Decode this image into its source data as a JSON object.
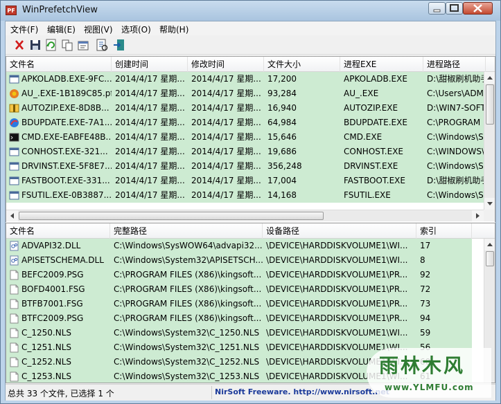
{
  "window": {
    "title": "WinPrefetchView",
    "icon_text": "PF"
  },
  "menu": [
    "文件(F)",
    "编辑(E)",
    "视图(V)",
    "选项(O)",
    "帮助(H)"
  ],
  "toolbar": [
    "delete-icon",
    "save-icon",
    "refresh-icon",
    "copy-icon",
    "properties-icon",
    "html-report-icon",
    "exit-icon"
  ],
  "top_table": {
    "headers": [
      "文件名",
      "创建时间",
      "修改时间",
      "文件大小",
      "进程EXE",
      "进程路径"
    ],
    "rows": [
      {
        "icon": "generic-exe-icon",
        "cells": [
          "APKOLADB.EXE-9FC...",
          "2014/4/17 星期...",
          "2014/4/17 星期...",
          "17,200",
          "APKOLADB.EXE",
          "D:\\甜椒刷机助手"
        ]
      },
      {
        "icon": "app-color-icon",
        "cells": [
          "AU_.EXE-1B189C85.pf",
          "2014/4/17 星期...",
          "2014/4/17 星期...",
          "93,284",
          "AU_.EXE",
          "C:\\Users\\ADM"
        ]
      },
      {
        "icon": "zip-icon",
        "cells": [
          "AUTOZIP.EXE-8D8B...",
          "2014/4/17 星期...",
          "2014/4/17 星期...",
          "16,940",
          "AUTOZIP.EXE",
          "D:\\WIN7-SOFT"
        ]
      },
      {
        "icon": "update-icon",
        "cells": [
          "BDUPDATE.EXE-7A1...",
          "2014/4/17 星期...",
          "2014/4/17 星期...",
          "64,984",
          "BDUPDATE.EXE",
          "C:\\PROGRAM"
        ]
      },
      {
        "icon": "cmd-icon",
        "cells": [
          "CMD.EXE-EABFE48B...",
          "2014/4/17 星期...",
          "2014/4/17 星期...",
          "15,646",
          "CMD.EXE",
          "C:\\Windows\\Sy"
        ]
      },
      {
        "icon": "generic-exe-icon",
        "cells": [
          "CONHOST.EXE-321...",
          "2014/4/17 星期...",
          "2014/4/17 星期...",
          "19,686",
          "CONHOST.EXE",
          "C:\\WINDOWS\\"
        ]
      },
      {
        "icon": "generic-exe-icon",
        "cells": [
          "DRVINST.EXE-5F8E7...",
          "2014/4/17 星期...",
          "2014/4/17 星期...",
          "356,248",
          "DRVINST.EXE",
          "C:\\Windows\\Sy"
        ]
      },
      {
        "icon": "generic-exe-icon",
        "cells": [
          "FASTBOOT.EXE-331...",
          "2014/4/17 星期...",
          "2014/4/17 星期...",
          "17,004",
          "FASTBOOT.EXE",
          "D:\\甜椒刷机助手"
        ]
      },
      {
        "icon": "generic-exe-icon",
        "cells": [
          "FSUTIL.EXE-0B3887...",
          "2014/4/17 星期...",
          "2014/4/17 星期...",
          "14,168",
          "FSUTIL.EXE",
          "C:\\Windows\\Sy"
        ]
      }
    ]
  },
  "bottom_table": {
    "headers": [
      "文件名",
      "完整路径",
      "设备路径",
      "索引"
    ],
    "rows": [
      {
        "icon": "dll-icon",
        "cells": [
          "ADVAPI32.DLL",
          "C:\\Windows\\SysWOW64\\advapi32....",
          "\\DEVICE\\HARDDISKVOLUME1\\WI...",
          "17"
        ]
      },
      {
        "icon": "dll-icon",
        "cells": [
          "APISETSCHEMA.DLL",
          "C:\\Windows\\System32\\APISETSCH...",
          "\\DEVICE\\HARDDISKVOLUME1\\WI...",
          "8"
        ]
      },
      {
        "icon": "file-icon",
        "cells": [
          "BEFC2009.PSG",
          "C:\\PROGRAM FILES (X86)\\kingsoft...",
          "\\DEVICE\\HARDDISKVOLUME1\\PR...",
          "92"
        ]
      },
      {
        "icon": "file-icon",
        "cells": [
          "BOFD4001.FSG",
          "C:\\PROGRAM FILES (X86)\\kingsoft...",
          "\\DEVICE\\HARDDISKVOLUME1\\PR...",
          "72"
        ]
      },
      {
        "icon": "file-icon",
        "cells": [
          "BTFB7001.FSG",
          "C:\\PROGRAM FILES (X86)\\kingsoft...",
          "\\DEVICE\\HARDDISKVOLUME1\\PR...",
          "73"
        ]
      },
      {
        "icon": "file-icon",
        "cells": [
          "BTFC2009.PSG",
          "C:\\PROGRAM FILES (X86)\\kingsoft...",
          "\\DEVICE\\HARDDISKVOLUME1\\PR...",
          "94"
        ]
      },
      {
        "icon": "file-icon",
        "cells": [
          "C_1250.NLS",
          "C:\\Windows\\System32\\C_1250.NLS",
          "\\DEVICE\\HARDDISKVOLUME1\\WI...",
          "59"
        ]
      },
      {
        "icon": "file-icon",
        "cells": [
          "C_1251.NLS",
          "C:\\Windows\\System32\\C_1251.NLS",
          "\\DEVICE\\HARDDISKVOLUME1\\WI...",
          "56"
        ]
      },
      {
        "icon": "file-icon",
        "cells": [
          "C_1252.NLS",
          "C:\\Windows\\System32\\C_1252.NLS",
          "\\DEVICE\\HARDDISKVOLUME1\\WI...",
          "60"
        ]
      },
      {
        "icon": "file-icon",
        "cells": [
          "C_1253.NLS",
          "C:\\Windows\\System32\\C_1253.NLS",
          "\\DEVICE\\HARDDISKVOLUME1\\WI...",
          "61"
        ]
      }
    ]
  },
  "status": {
    "count": "总共 33 个文件, 已选择 1 个",
    "link": "NirSoft Freeware.  http://www.nirsoft.net"
  },
  "watermark": {
    "title": "雨林木风",
    "sub": "www.YLMFU.com"
  },
  "colors": {
    "row_bg": "#cdebd2",
    "title_bar": "#bcd3ea",
    "link": "#1b3a9a",
    "watermark": "#2e7d32"
  }
}
